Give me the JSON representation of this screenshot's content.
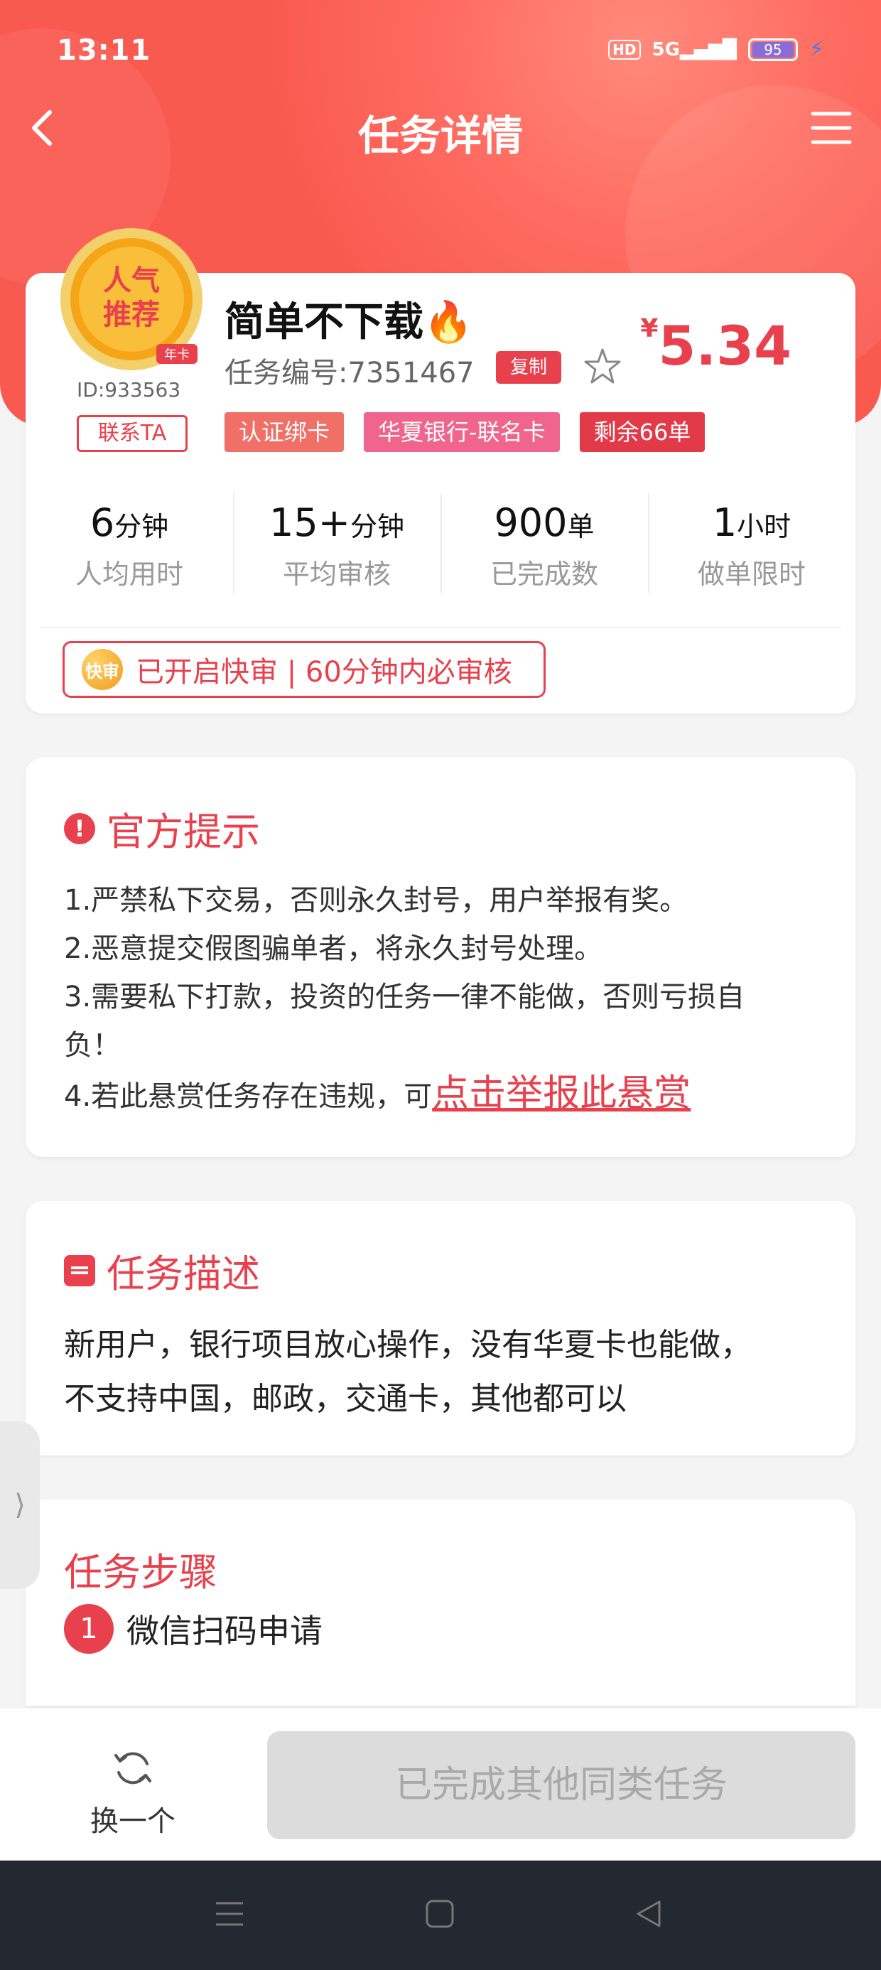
{
  "status_bar": {
    "time": "13:11",
    "hd": "HD",
    "network": "5G",
    "battery": "95"
  },
  "nav": {
    "title": "任务详情"
  },
  "task": {
    "badge_text_line1": "人气",
    "badge_text_line2": "推荐",
    "badge_ribbon": "年卡",
    "user_id": "ID:933563",
    "contact_label": "联系TA",
    "title": "简单不下载🔥",
    "task_no": "任务编号:7351467",
    "copy_label": "复制",
    "price_symbol": "¥",
    "price_value": "5.34",
    "tags": [
      "认证绑卡",
      "华夏银行-联名卡",
      "剩余66单"
    ]
  },
  "stats": [
    {
      "value": "6",
      "unit": "分钟",
      "label": "人均用时"
    },
    {
      "value": "15+",
      "unit": "分钟",
      "label": "平均审核"
    },
    {
      "value": "900",
      "unit": "单",
      "label": "已完成数"
    },
    {
      "value": "1",
      "unit": "小时",
      "label": "做单限时"
    }
  ],
  "fast_review": {
    "icon_text": "快审",
    "text": "已开启快审 | 60分钟内必审核"
  },
  "tips": {
    "title": "官方提示",
    "lines": [
      "1.严禁私下交易，否则永久封号，用户举报有奖。",
      "2.恶意提交假图骗单者，将永久封号处理。",
      "3.需要私下打款，投资的任务一律不能做，否则亏损自",
      "负！"
    ],
    "line4_prefix": "4.若此悬赏任务存在违规，可",
    "report_link": "点击举报此悬赏"
  },
  "description": {
    "title": "任务描述",
    "lines": [
      "新用户，银行项目放心操作，没有华夏卡也能做，",
      "不支持中国，邮政，交通卡，其他都可以"
    ]
  },
  "steps": {
    "title": "任务步骤",
    "items": [
      {
        "num": "1",
        "text": "微信扫码申请"
      }
    ]
  },
  "bottom": {
    "switch_label": "换一个",
    "done_label": "已完成其他同类任务"
  },
  "colors": {
    "accent": "#e8414d",
    "header": "#f95a50"
  }
}
